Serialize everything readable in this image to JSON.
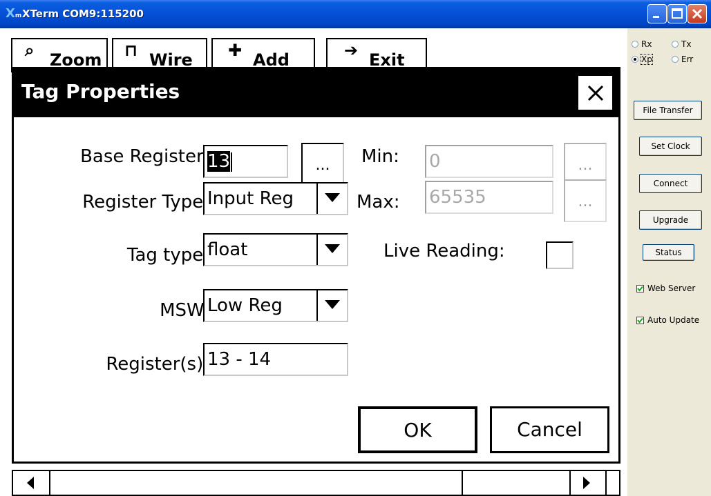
{
  "window": {
    "title": "XTerm COM9:115200",
    "app_icon_glyph": "X",
    "app_icon_sub": "m"
  },
  "toolbar": {
    "zoom": {
      "label": "Zoom",
      "icon": "magnifier-icon",
      "glyph": "⌕"
    },
    "wire": {
      "label": "Wire",
      "icon": "wire-icon",
      "glyph": "⊓"
    },
    "add": {
      "label": "Add",
      "icon": "plus-icon",
      "glyph": "✚"
    },
    "exit": {
      "label": "Exit",
      "icon": "arrow-right-icon",
      "glyph": "➔"
    }
  },
  "dialog": {
    "title": "Tag Properties",
    "close_glyph": "✕",
    "fields": {
      "base_register": {
        "label": "Base Register:",
        "value": "13"
      },
      "register_type": {
        "label": "Register Type:",
        "value": "Input Reg"
      },
      "tag_type": {
        "label": "Tag type:",
        "value": "float"
      },
      "msw": {
        "label": "MSW:",
        "value": "Low Reg"
      },
      "registers": {
        "label": "Register(s):",
        "value": "13 - 14"
      },
      "min": {
        "label": "Min:",
        "value": "0"
      },
      "max": {
        "label": "Max:",
        "value": "65535"
      },
      "live_reading": {
        "label": "Live Reading:",
        "checked": false
      }
    },
    "ellipsis_label": "...",
    "ok_label": "OK",
    "cancel_label": "Cancel"
  },
  "side_panel": {
    "radios": [
      {
        "label": "Rx",
        "checked": false
      },
      {
        "label": "Tx",
        "checked": false
      },
      {
        "label": "Xp",
        "checked": true
      },
      {
        "label": "Err",
        "checked": false
      }
    ],
    "buttons": {
      "file_transfer": "File Transfer",
      "set_clock": "Set Clock",
      "connect": "Connect",
      "upgrade": "Upgrade",
      "status": "Status"
    },
    "checkboxes": {
      "web_server": {
        "label": "Web Server",
        "checked": true
      },
      "auto_update": {
        "label": "Auto Update",
        "checked": true
      }
    }
  },
  "colors": {
    "titlebar_blue": "#0651d8",
    "panel_bg": "#ece9d8",
    "dialog_header": "#000000"
  }
}
